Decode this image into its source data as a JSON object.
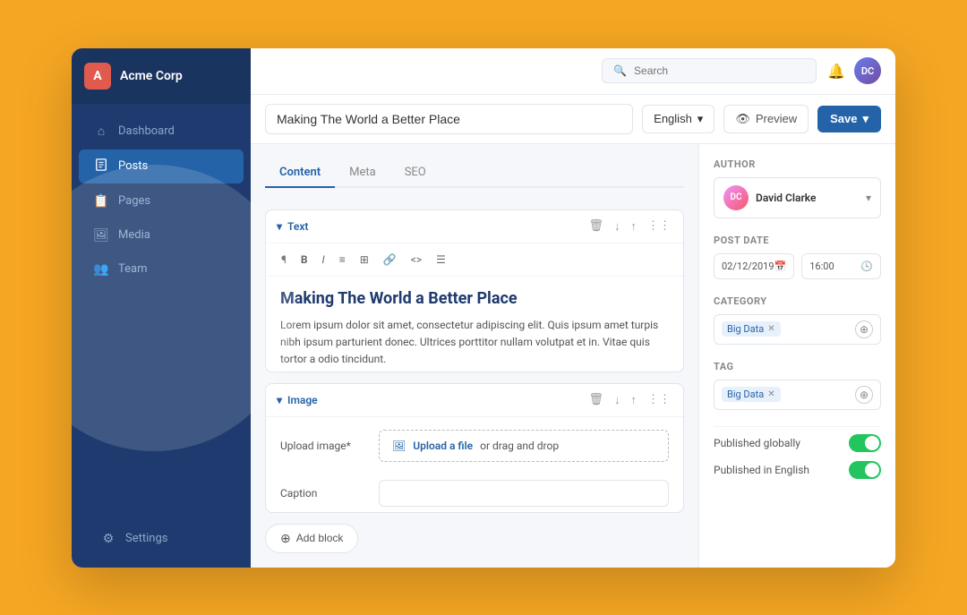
{
  "brand": {
    "initial": "A",
    "name": "Acme Corp"
  },
  "sidebar": {
    "items": [
      {
        "id": "dashboard",
        "label": "Dashboard",
        "icon": "⌂",
        "active": false
      },
      {
        "id": "posts",
        "label": "Posts",
        "icon": "📄",
        "active": true
      },
      {
        "id": "pages",
        "label": "Pages",
        "icon": "📋",
        "active": false
      },
      {
        "id": "media",
        "label": "Media",
        "icon": "🖼",
        "active": false
      },
      {
        "id": "team",
        "label": "Team",
        "icon": "👥",
        "active": false
      }
    ],
    "bottom_item": {
      "id": "settings",
      "label": "Settings",
      "icon": "⚙"
    }
  },
  "topbar": {
    "search_placeholder": "Search"
  },
  "post": {
    "title": "Making The World a Better Place",
    "lang": "English",
    "preview_label": "Preview",
    "save_label": "Save"
  },
  "tabs": [
    {
      "id": "content",
      "label": "Content",
      "active": true
    },
    {
      "id": "meta",
      "label": "Meta",
      "active": false
    },
    {
      "id": "seo",
      "label": "SEO",
      "active": false
    }
  ],
  "blocks": {
    "text_block": {
      "label": "Text",
      "title": "Making The World a Better Place",
      "body": "Lorem ipsum dolor sit amet, consectetur adipiscing elit. Quis ipsum amet turpis nibh ipsum parturient donec. Ultrices porttitor nullam volutpat et in. Vitae quis tortor a odio tincidunt."
    },
    "image_block": {
      "label": "Image",
      "upload_label": "Upload image*",
      "upload_text": "Upload a file",
      "upload_suffix": " or drag and drop",
      "caption_label": "Caption"
    }
  },
  "add_block": {
    "label": "Add block"
  },
  "right_panel": {
    "author_label": "Author",
    "author_name": "David Clarke",
    "post_date_label": "Post date",
    "post_date": "02/12/2019",
    "post_time": "16:00",
    "category_label": "Category",
    "category_tag": "Big Data",
    "tag_label": "Tag",
    "tag_value": "Big Data",
    "published_globally_label": "Published globally",
    "published_globally": true,
    "published_in_english_label": "Published in English",
    "published_in_english": true
  }
}
